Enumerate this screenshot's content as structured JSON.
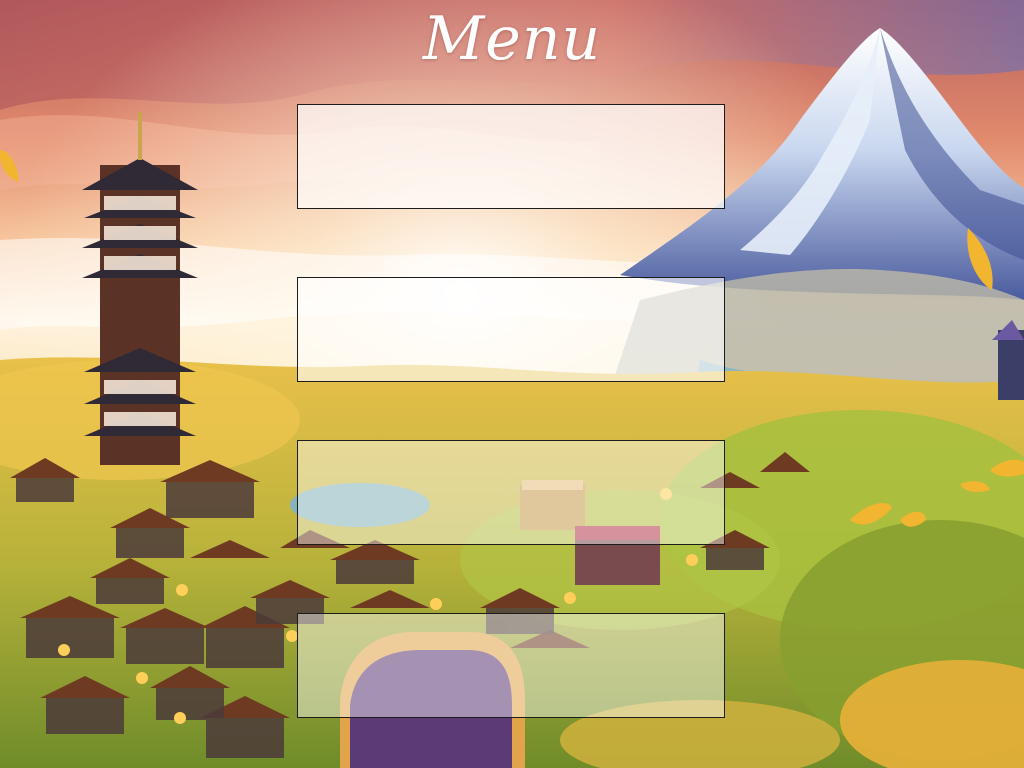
{
  "screen": {
    "title": "Menu"
  },
  "menu": {
    "buttons": [
      {
        "label": ""
      },
      {
        "label": ""
      },
      {
        "label": ""
      },
      {
        "label": ""
      }
    ]
  },
  "palette": {
    "sky_top": "#c9706a",
    "sky_glow": "#fbe6c8",
    "mountain_snow": "#f4f7fb",
    "mountain_shadow": "#4a5b9e",
    "foliage_gold": "#e6b53a",
    "foliage_green": "#9cb83a",
    "roof_brown": "#6e3b22",
    "panel_border": "#1c1c1c"
  }
}
